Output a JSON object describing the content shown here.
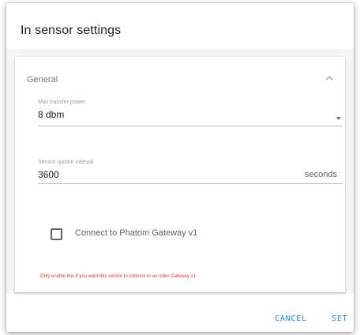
{
  "dialog": {
    "title": "In sensor settings",
    "cancel_label": "CANCEL",
    "set_label": "SET"
  },
  "panel": {
    "title": "General",
    "max_power": {
      "label": "Max transfer power",
      "value": "8 dbm"
    },
    "interval": {
      "label": "Sensor update interval",
      "value": "3600",
      "suffix": "seconds"
    },
    "checkbox": {
      "label": "Connect to Phatom Gateway v1",
      "checked": false
    },
    "warning": "Only enable this if you want this sensor to connect to an older Gateway v1"
  },
  "icons": {
    "expander": "chevron-up-icon",
    "dropdown": "dropdown-arrow-icon"
  },
  "colors": {
    "accent": "#1e88e5",
    "warning": "#e53935"
  }
}
